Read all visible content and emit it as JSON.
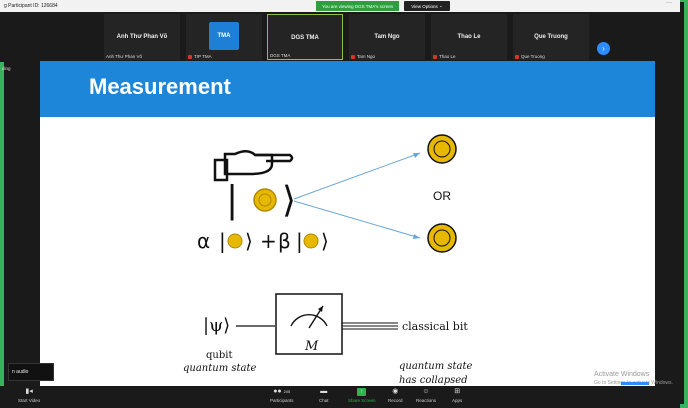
{
  "window": {
    "meeting_id_text": "g Participant ID: 126684",
    "viewing_banner": "You are viewing DGS TMA's screen",
    "view_options": "View Options",
    "more_icon": "ellipsis-icon"
  },
  "participants": [
    {
      "name": "Anh Thư Phan Võ",
      "label": "Anh Thư Phan Võ",
      "muted": false
    },
    {
      "name": "",
      "label": "TIP TMA",
      "muted": true,
      "logo_text": "TMA"
    },
    {
      "name": "DGS TMA",
      "label": "DGS TMA",
      "muted": false,
      "active": true
    },
    {
      "name": "Tam Ngo",
      "label": "Tam Ngo",
      "muted": true
    },
    {
      "name": "Thao Le",
      "label": "Thao Le",
      "muted": true
    },
    {
      "name": "Que Truong",
      "label": "Que Truong",
      "muted": true
    }
  ],
  "left_label": "ding",
  "slide": {
    "title": "Measurement",
    "or_text": "OR",
    "alpha": "α",
    "beta": "β",
    "plus": "+",
    "psi_ket": "|ψ⟩",
    "meter_label": "M",
    "classical_bit": "classical bit",
    "qubit": "qubit",
    "quantum_state": "quantum state",
    "collapsed_1": "quantum state",
    "collapsed_2": "has collapsed"
  },
  "audio_box": "n audio",
  "toolbar": {
    "start_video": "Start Video",
    "participants": "Participants",
    "participants_count": "205",
    "chat": "Chat",
    "share_screen": "Share Screen",
    "record": "Record",
    "reactions": "Reactions",
    "apps": "Apps"
  },
  "watermark": {
    "line1": "Activate Windows",
    "line2": "Go to Settings to activate Windows."
  },
  "colors": {
    "slide_header": "#1d86d8",
    "share_green": "#2fb34a",
    "frame_green": "#3bb25d",
    "coin_gold": "#e6b800"
  }
}
